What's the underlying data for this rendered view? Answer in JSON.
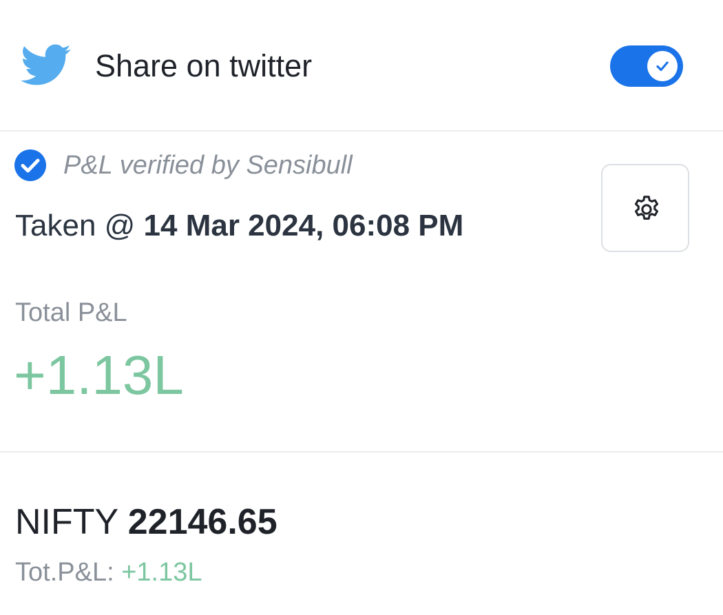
{
  "share": {
    "icon": "twitter-icon",
    "label": "Share on twitter",
    "toggle_on": true,
    "accent_color": "#1a73e8"
  },
  "verification": {
    "icon": "check-circle-icon",
    "text": "P&L verified by Sensibull"
  },
  "snapshot": {
    "prefix": "Taken @",
    "timestamp": "14 Mar 2024, 06:08 PM",
    "settings_icon": "gear-icon"
  },
  "pnl": {
    "label": "Total P&L",
    "value": "+1.13L",
    "value_color": "#7cc6a0"
  },
  "position": {
    "symbol": "NIFTY",
    "price": "22146.65",
    "tot_label": "Tot.P&L:",
    "tot_value": "+1.13L"
  }
}
